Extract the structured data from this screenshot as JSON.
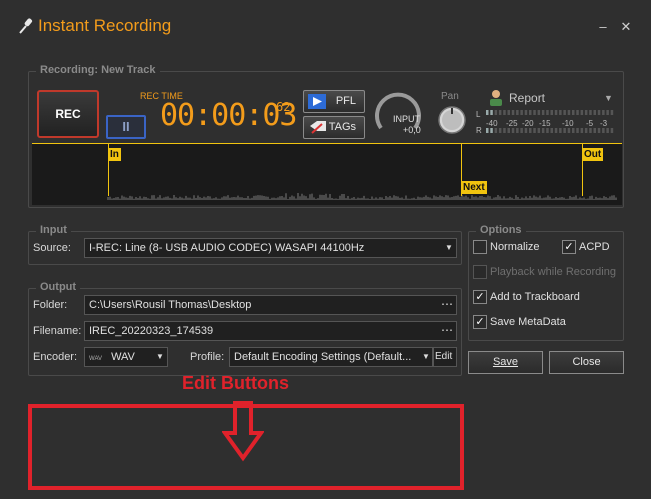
{
  "window": {
    "title": "Instant Recording"
  },
  "recording": {
    "group_label": "Recording: New Track",
    "rec_label": "REC",
    "pause_label": "II",
    "rec_time_label": "REC TIME",
    "rec_time": "00:00:03",
    "rec_time_ms": "62",
    "pfl_label": "PFL",
    "tags_label": "TAGs",
    "input_label": "INPUT",
    "input_value": "+0,0",
    "pan_label": "Pan",
    "report_label": "Report",
    "meter_scale": [
      "-40",
      "-25",
      "-20",
      "-15",
      "-10",
      "-5",
      "-3"
    ],
    "meter_channels": [
      "L",
      "R"
    ],
    "markers": {
      "in": "In",
      "next": "Next",
      "out": "Out"
    }
  },
  "input": {
    "group_label": "Input",
    "source_label": "Source:",
    "source_value": "I-REC: Line (8- USB AUDIO  CODEC) WASAPI 44100Hz"
  },
  "output": {
    "group_label": "Output",
    "folder_label": "Folder:",
    "folder_value": "C:\\Users\\Rousil Thomas\\Desktop",
    "filename_label": "Filename:",
    "filename_value": "IREC_20220323_174539",
    "encoder_label": "Encoder:",
    "encoder_value": "WAV",
    "encoder_icon_text": "WAV",
    "profile_label": "Profile:",
    "profile_value": "Default Encoding Settings (Default...",
    "edit_label": "Edit"
  },
  "options": {
    "group_label": "Options",
    "normalize": {
      "label": "Normalize",
      "checked": false
    },
    "acpd": {
      "label": "ACPD",
      "checked": true
    },
    "playback": {
      "label": "Playback while Recording",
      "checked": false,
      "disabled": true
    },
    "trackboard": {
      "label": "Add to Trackboard",
      "checked": true
    },
    "metadata": {
      "label": "Save MetaData",
      "checked": true
    }
  },
  "buttons": {
    "save": "Save",
    "close": "Close"
  },
  "annotation": {
    "label": "Edit Buttons"
  },
  "colors": {
    "accent": "#f39c1b",
    "marker": "#f1c40f",
    "annotation": "#e0222b"
  }
}
